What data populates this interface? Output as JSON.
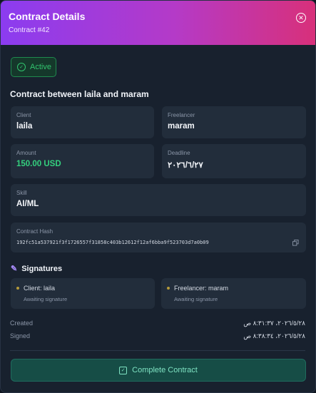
{
  "header": {
    "title": "Contract Details",
    "subtitle": "Contract #42",
    "close_icon": "close-circle-icon"
  },
  "status": {
    "label": "Active",
    "icon": "check-circle-icon",
    "color": "#31c46e"
  },
  "contract": {
    "title": "Contract between laila and maram"
  },
  "fields": {
    "client": {
      "label": "Client",
      "value": "laila"
    },
    "freelancer": {
      "label": "Freelancer",
      "value": "maram"
    },
    "amount": {
      "label": "Amount",
      "value": "150.00 USD",
      "color": "#34d07e"
    },
    "deadline": {
      "label": "Deadline",
      "value": "٢٠٢٦/٦/٢٧"
    },
    "skill": {
      "label": "Skill",
      "value": "AI/ML"
    },
    "hash": {
      "label": "Contract Hash",
      "value": "192fc51a537921f3f1726557f31858c403b12612f12af6bba9f523703d7a0b09",
      "copy_icon": "copy-icon"
    }
  },
  "signatures": {
    "heading": "Signatures",
    "icon": "edit-icon",
    "client": {
      "name": "Client: laila",
      "status": "Awaiting signature"
    },
    "freelancer": {
      "name": "Freelancer: maram",
      "status": "Awaiting signature"
    }
  },
  "meta": {
    "created": {
      "label": "Created",
      "value": "٢٠٢٦/٥/٢٨، ٨:٣١:٣٧ ص"
    },
    "signed": {
      "label": "Signed",
      "value": "٢٠٢٦/٥/٢٨، ٨:٣٨:٣٤ ص"
    }
  },
  "action": {
    "label": "Complete Contract",
    "icon": "check-square-icon"
  }
}
